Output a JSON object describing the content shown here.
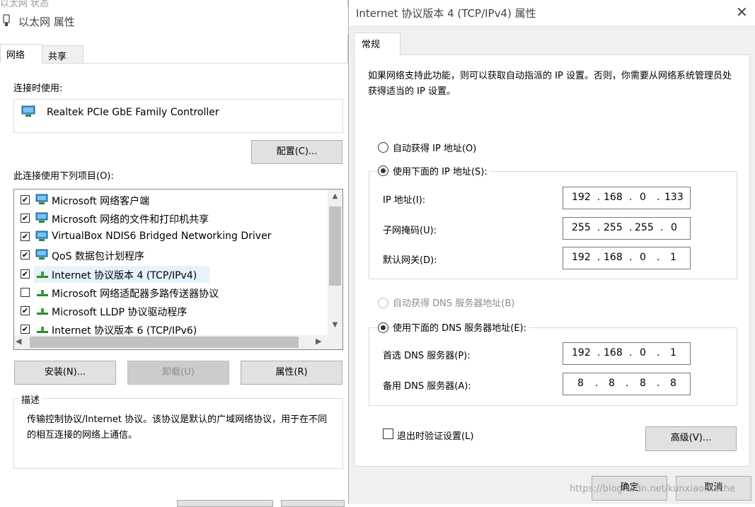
{
  "left_window": {
    "behind_title": "以太网 状态",
    "title": "以太网 属性",
    "tabs": [
      "网络",
      "共享"
    ],
    "connect_using_label": "连接时使用:",
    "adapter_name": "Realtek PCIe GbE Family Controller",
    "configure_button": "配置(C)...",
    "items_label": "此连接使用下列项目(O):",
    "items": [
      {
        "label": "Microsoft 网络客户端",
        "checked": true
      },
      {
        "label": "Microsoft 网络的文件和打印机共享",
        "checked": true
      },
      {
        "label": "VirtualBox NDIS6 Bridged Networking Driver",
        "checked": true
      },
      {
        "label": "QoS 数据包计划程序",
        "checked": true
      },
      {
        "label": "Internet 协议版本 4 (TCP/IPv4)",
        "checked": true
      },
      {
        "label": "Microsoft 网络适配器多路传送器协议",
        "checked": false
      },
      {
        "label": "Microsoft LLDP 协议驱动程序",
        "checked": true
      },
      {
        "label": "Internet 协议版本 6 (TCP/IPv6)",
        "checked": true
      }
    ],
    "install_button": "安装(N)...",
    "uninstall_button": "卸载(U)",
    "properties_button": "属性(R)",
    "description_legend": "描述",
    "description_text": "传输控制协议/Internet 协议。该协议是默认的广域网络协议，用于在不同的相互连接的网络上通信。"
  },
  "right_window": {
    "title": "Internet 协议版本 4 (TCP/IPv4) 属性",
    "tab": "常规",
    "intro": "如果网络支持此功能，则可以获取自动指派的 IP 设置。否则，你需要从网络系统管理员处获得适当的 IP 设置。",
    "auto_ip_label": "自动获得 IP 地址(O)",
    "manual_ip_label": "使用下面的 IP 地址(S):",
    "ip_address_label": "IP 地址(I):",
    "ip_address": [
      "192",
      "168",
      "0",
      "133"
    ],
    "subnet_mask_label": "子网掩码(U):",
    "subnet_mask": [
      "255",
      "255",
      "255",
      "0"
    ],
    "gateway_label": "默认网关(D):",
    "gateway": [
      "192",
      "168",
      "0",
      "1"
    ],
    "auto_dns_label": "自动获得 DNS 服务器地址(B)",
    "manual_dns_label": "使用下面的 DNS 服务器地址(E):",
    "preferred_dns_label": "首选 DNS 服务器(P):",
    "preferred_dns": [
      "192",
      "168",
      "0",
      "1"
    ],
    "alternate_dns_label": "备用 DNS 服务器(A):",
    "alternate_dns": [
      "8",
      "8",
      "8",
      "8"
    ],
    "validate_label": "退出时验证设置(L)",
    "advanced_button": "高级(V)...",
    "ok_button": "确定",
    "cancel_button": "取消"
  },
  "watermark": "https://blog.csdn.net/kunxiaomache",
  "colors": {
    "dialog_bg": "#f0f0f0",
    "button_bg": "#e1e1e1",
    "button_border": "#adadad",
    "selection_bg": "#e5f3fb",
    "disabled_text": "#8c8c8c"
  },
  "icons": [
    "ethernet-plug-icon",
    "network-adapter-icon",
    "network-client-icon",
    "protocol-icon",
    "close-icon",
    "scroll-up-icon",
    "scroll-down-icon",
    "scroll-left-icon",
    "scroll-right-icon"
  ]
}
